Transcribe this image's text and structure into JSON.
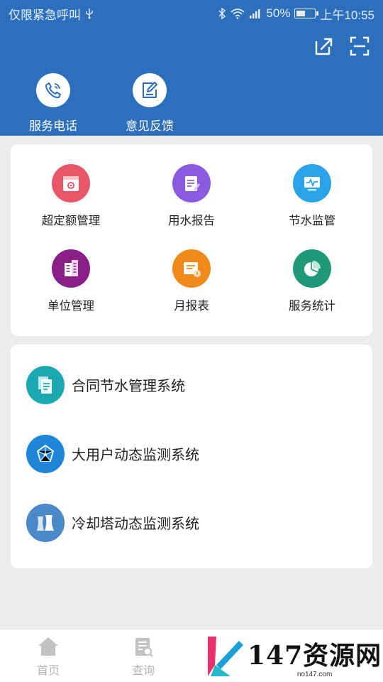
{
  "status_bar": {
    "carrier": "仅限紧急呼叫",
    "usb_icon": "usb-icon",
    "bluetooth_icon": "bluetooth-icon",
    "wifi_icon": "wifi-icon",
    "signal_icon": "signal-icon",
    "battery_percent": "50%",
    "battery_level": 0.5,
    "time": "上午10:55"
  },
  "header": {
    "background_color": "#2b6fbd",
    "actions": [
      {
        "icon": "share-icon"
      },
      {
        "icon": "scan-icon"
      }
    ],
    "quick_items": [
      {
        "label": "服务电话",
        "icon": "phone-icon"
      },
      {
        "label": "意见反馈",
        "icon": "feedback-icon"
      }
    ]
  },
  "grid": {
    "items": [
      {
        "label": "超定额管理",
        "icon": "calendar-gear-icon",
        "color": "#e8566a"
      },
      {
        "label": "用水报告",
        "icon": "report-icon",
        "color": "#8a5ae0"
      },
      {
        "label": "节水监管",
        "icon": "monitor-icon",
        "color": "#2ba3ea"
      },
      {
        "label": "单位管理",
        "icon": "building-icon",
        "color": "#8a1f8a"
      },
      {
        "label": "月报表",
        "icon": "monthly-report-icon",
        "color": "#f28a1a"
      },
      {
        "label": "服务统计",
        "icon": "pie-chart-icon",
        "color": "#1f9a78"
      }
    ]
  },
  "systems": {
    "items": [
      {
        "label": "合同节水管理系统",
        "icon": "documents-icon",
        "color": "#1ca8b0"
      },
      {
        "label": "大用户动态监测系统",
        "icon": "network-icon",
        "color": "#1d86d8"
      },
      {
        "label": "冷却塔动态监测系统",
        "icon": "cooling-tower-icon",
        "color": "#4a88c8"
      }
    ]
  },
  "tabbar": {
    "tabs": [
      {
        "label": "首页",
        "icon": "home-icon"
      },
      {
        "label": "查询",
        "icon": "query-icon"
      }
    ]
  },
  "watermark": {
    "title": "147资源网",
    "subtitle": "no147.com"
  }
}
